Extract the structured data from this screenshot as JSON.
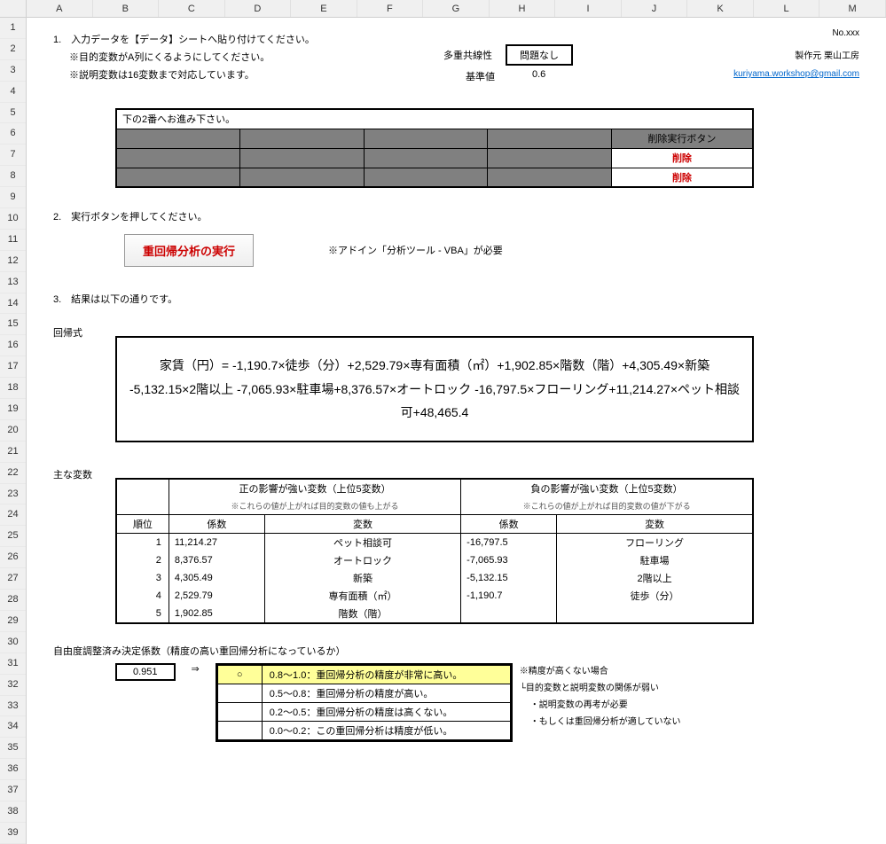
{
  "columns": [
    "A",
    "B",
    "C",
    "D",
    "E",
    "F",
    "G",
    "H",
    "I",
    "J",
    "K",
    "L",
    "M"
  ],
  "row_count": 39,
  "section1": {
    "title": "1.　入力データを【データ】シートへ貼り付けてください。",
    "note1": "※目的変数がA列にくるようにしてください。",
    "note2": "※説明変数は16変数まで対応しています。",
    "no_label": "No.xxx",
    "maker": "製作元 栗山工房",
    "email": "kuriyama.workshop@gmail.com",
    "multicol_label": "多重共線性",
    "multicol_value": "問題なし",
    "base_label": "基準値",
    "base_value": "0.6"
  },
  "gray_table": {
    "instruction": "下の2番へお進み下さい。",
    "del_header": "削除実行ボタン",
    "del_label1": "削除",
    "del_label2": "削除"
  },
  "section2": {
    "title": "2.　実行ボタンを押してください。",
    "run_button": "重回帰分析の実行",
    "addin_note": "※アドイン「分析ツール - VBA」が必要"
  },
  "section3": {
    "title": "3.　結果は以下の通りです。"
  },
  "formula": {
    "label": "回帰式",
    "text": "家賃（円）= -1,190.7×徒歩（分）+2,529.79×専有面積（㎡）+1,902.85×階数（階）+4,305.49×新築 -5,132.15×2階以上 -7,065.93×駐車場+8,376.57×オートロック -16,797.5×フローリング+11,214.27×ペット相談可+48,465.4"
  },
  "mainvars": {
    "label": "主な変数",
    "pos_header": "正の影響が強い変数（上位5変数）",
    "pos_sub": "※これらの値が上がれば目的変数の値も上がる",
    "neg_header": "負の影響が強い変数（上位5変数）",
    "neg_sub": "※これらの値が上がれば目的変数の値が下がる",
    "col_rank": "順位",
    "col_coef": "係数",
    "col_var": "変数",
    "rows": [
      {
        "rank": "1",
        "pcoef": "11,214.27",
        "pvar": "ペット相談可",
        "ncoef": "-16,797.5",
        "nvar": "フローリング"
      },
      {
        "rank": "2",
        "pcoef": "8,376.57",
        "pvar": "オートロック",
        "ncoef": "-7,065.93",
        "nvar": "駐車場"
      },
      {
        "rank": "3",
        "pcoef": "4,305.49",
        "pvar": "新築",
        "ncoef": "-5,132.15",
        "nvar": "2階以上"
      },
      {
        "rank": "4",
        "pcoef": "2,529.79",
        "pvar": "専有面積（㎡）",
        "ncoef": "-1,190.7",
        "nvar": "徒歩（分）"
      },
      {
        "rank": "5",
        "pcoef": "1,902.85",
        "pvar": "階数（階）",
        "ncoef": "",
        "nvar": ""
      }
    ]
  },
  "r2": {
    "label": "自由度調整済み決定係数（精度の高い重回帰分析になっているか）",
    "value": "0.951",
    "arrow": "⇒",
    "grades": [
      {
        "mark": "○",
        "desc": "0.8～1.0：重回帰分析の精度が非常に高い。",
        "hl": true
      },
      {
        "mark": "",
        "desc": "0.5～0.8：重回帰分析の精度が高い。",
        "hl": false
      },
      {
        "mark": "",
        "desc": "0.2～0.5：重回帰分析の精度は高くない。",
        "hl": false
      },
      {
        "mark": "",
        "desc": "0.0～0.2：この重回帰分析は精度が低い。",
        "hl": false
      }
    ],
    "note_title": "※精度が高くない場合",
    "note1": "└目的変数と説明変数の関係が弱い",
    "note2": "・説明変数の再考が必要",
    "note3": "・もしくは重回帰分析が適していない"
  }
}
